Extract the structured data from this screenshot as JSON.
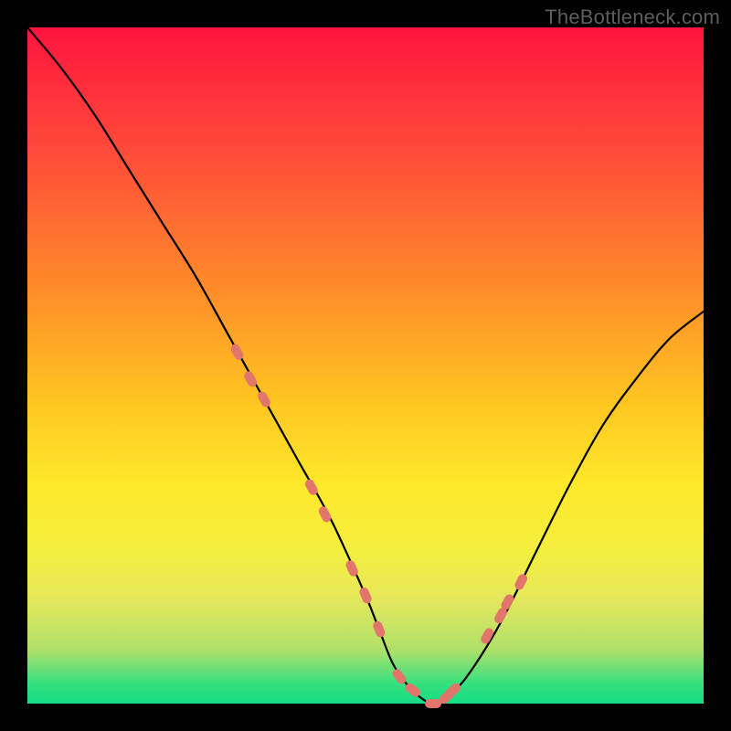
{
  "watermark": "TheBottleneck.com",
  "colors": {
    "curve_stroke": "#000000",
    "marker_fill": "#e2756c",
    "marker_stroke": "#e2756c",
    "gradient_top": "#ff143e",
    "gradient_bottom": "#12dc84",
    "bg": "#000000"
  },
  "chart_data": {
    "type": "line",
    "title": "",
    "xlabel": "",
    "ylabel": "",
    "xlim": [
      0,
      100
    ],
    "ylim": [
      0,
      100
    ],
    "grid": false,
    "series": [
      {
        "name": "bottleneck-curve",
        "x": [
          0,
          5,
          10,
          15,
          20,
          25,
          30,
          35,
          40,
          45,
          50,
          52,
          54,
          56,
          58,
          60,
          62,
          65,
          70,
          75,
          80,
          85,
          90,
          95,
          100
        ],
        "y": [
          100,
          94,
          87,
          79,
          71,
          63,
          54,
          45,
          36,
          27,
          16,
          11,
          6,
          3,
          1,
          0,
          1,
          4,
          12,
          22,
          32,
          41,
          48,
          54,
          58
        ]
      }
    ],
    "markers": {
      "name": "highlight-points",
      "x": [
        31,
        33,
        35,
        42,
        44,
        48,
        50,
        52,
        55,
        57,
        60,
        62,
        63,
        68,
        70,
        71,
        73
      ],
      "y": [
        52,
        48,
        45,
        32,
        28,
        20,
        16,
        11,
        4,
        2,
        0,
        1,
        2,
        10,
        13,
        15,
        18
      ]
    }
  }
}
